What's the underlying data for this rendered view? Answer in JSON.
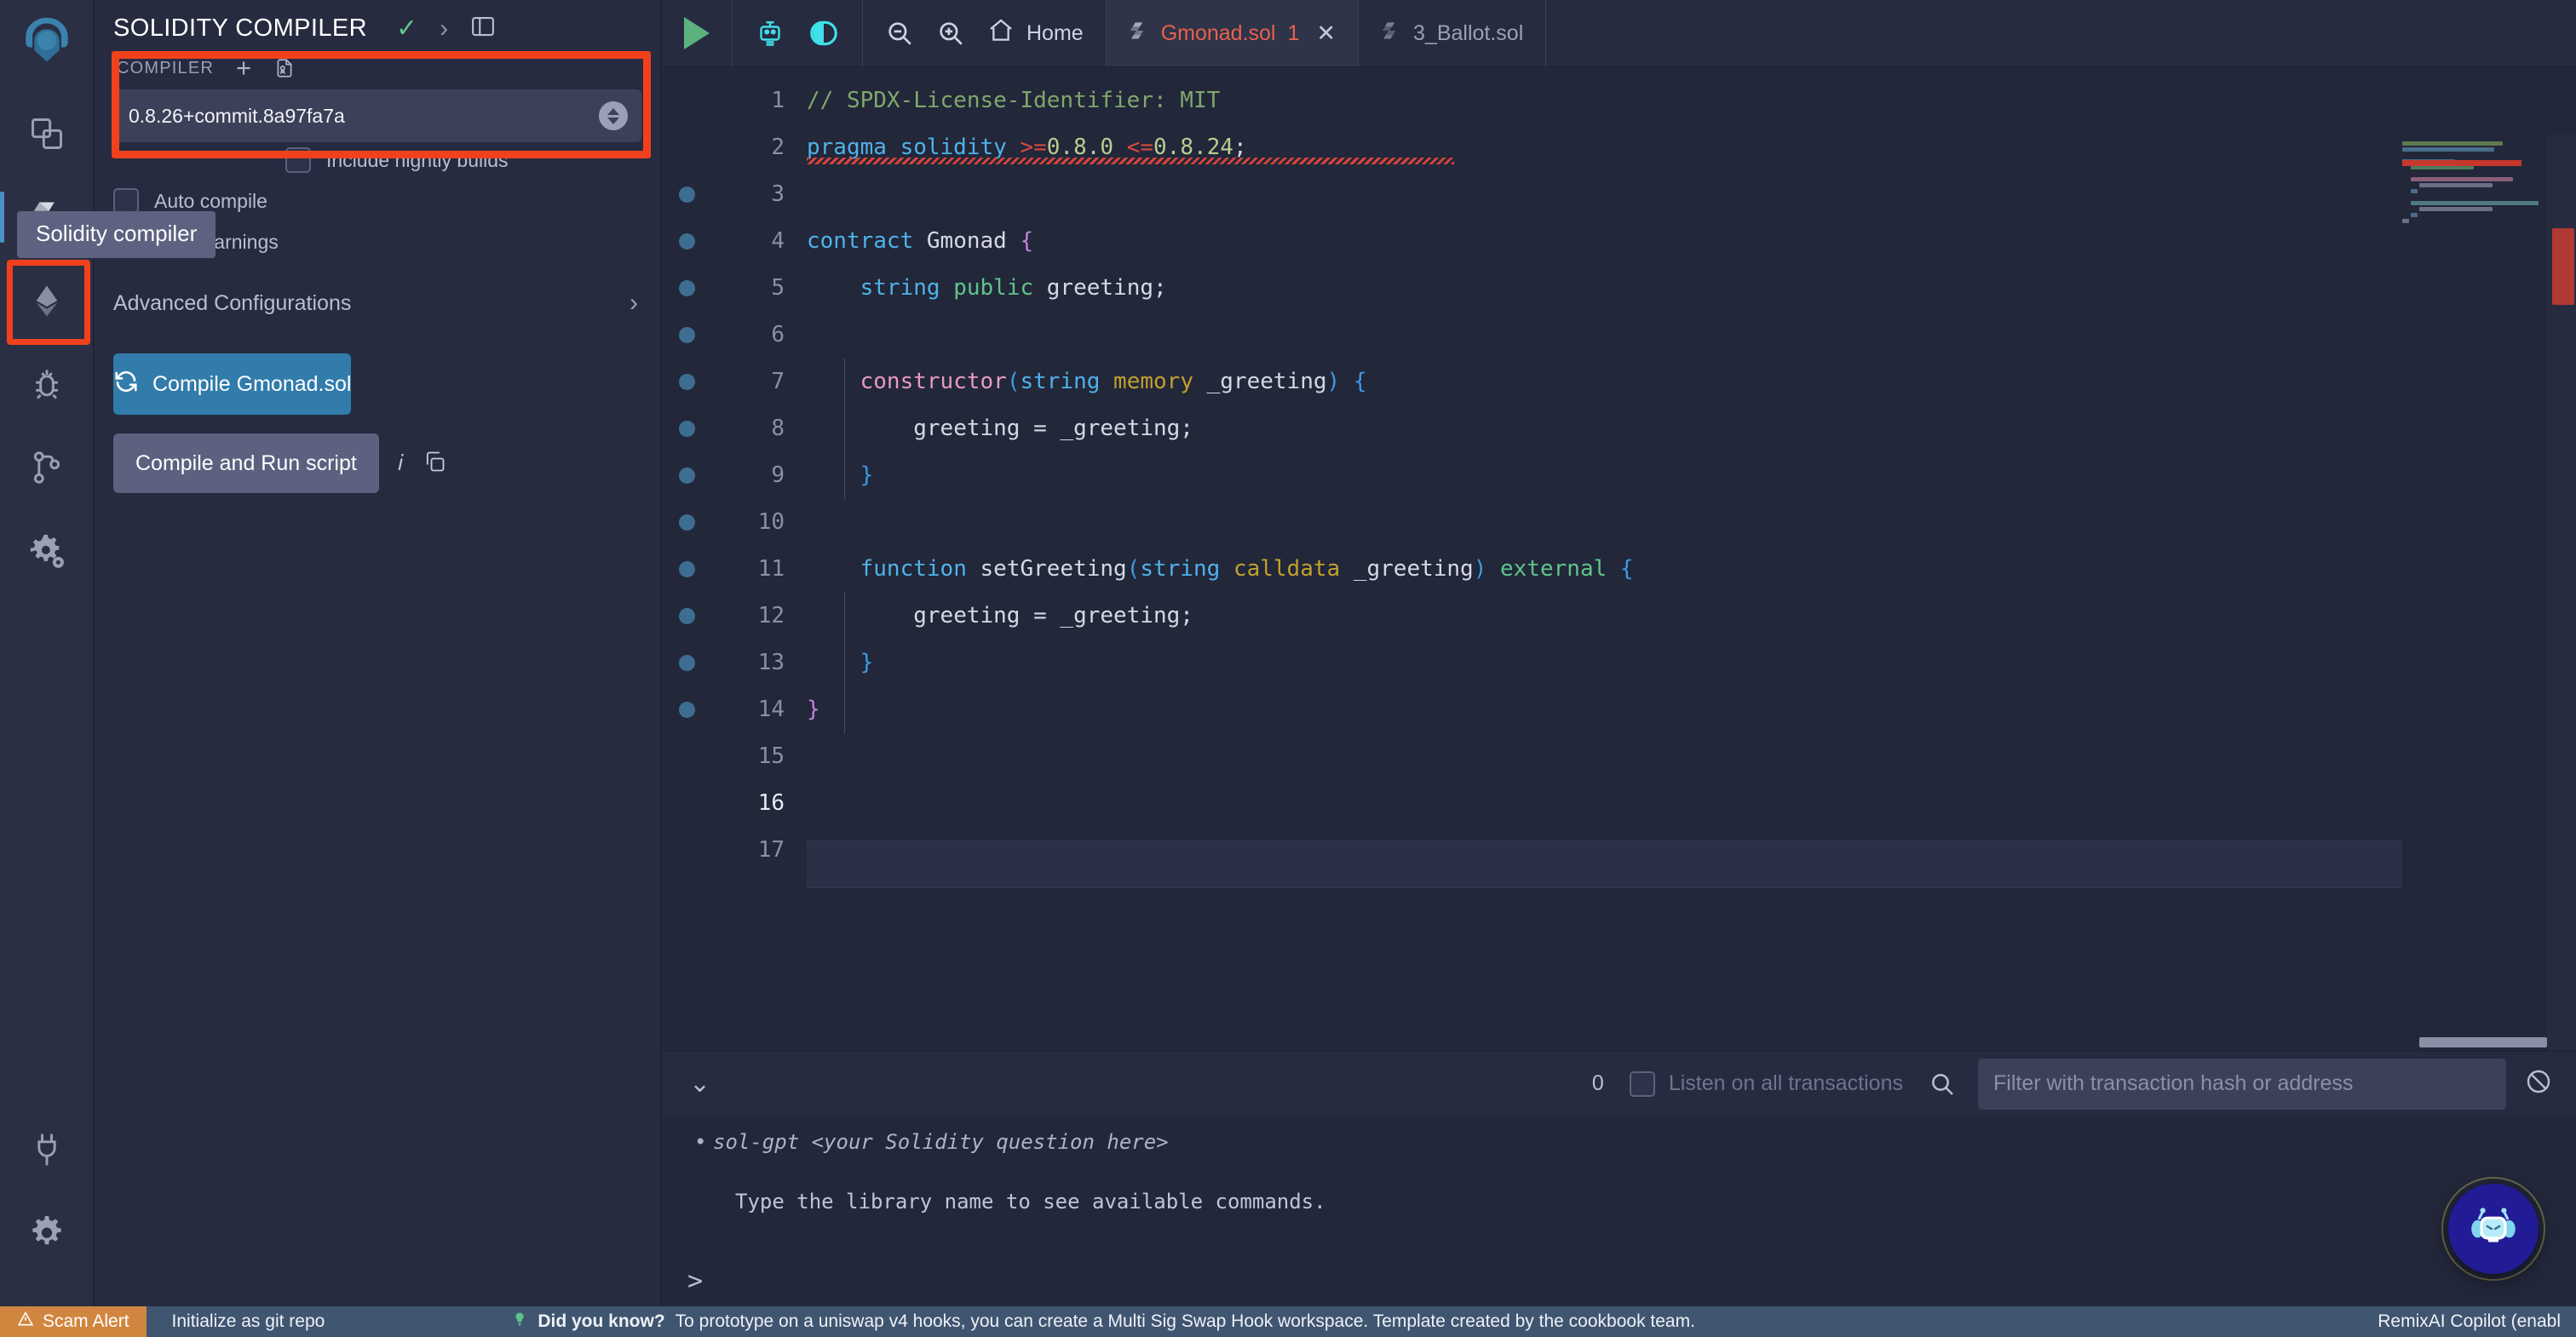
{
  "iconbar": {
    "items": [
      {
        "name": "remix-logo",
        "label": "Remix"
      },
      {
        "name": "file-explorer",
        "label": "File explorer"
      },
      {
        "name": "solidity-compiler",
        "label": "Solidity compiler"
      },
      {
        "name": "deploy-run",
        "label": "Deploy & run transactions"
      },
      {
        "name": "debugger",
        "label": "Debugger"
      },
      {
        "name": "git",
        "label": "Git"
      },
      {
        "name": "plugin-manager-settings",
        "label": "Settings"
      },
      {
        "name": "plugin-manager",
        "label": "Plugin manager"
      },
      {
        "name": "settings",
        "label": "Settings"
      }
    ]
  },
  "tooltip": {
    "text": "Solidity compiler"
  },
  "panel": {
    "title": "SOLIDITY COMPILER",
    "header_icons": [
      "check-icon",
      "chevron-right-icon",
      "panel-layout-icon"
    ],
    "compiler_label": "COMPILER",
    "compiler_version": "0.8.26+commit.8a97fa7a",
    "nightly_label": "Include nightly builds",
    "auto_compile_label": "Auto compile",
    "hide_warnings_label": "Hide warnings",
    "advanced_label": "Advanced Configurations",
    "compile_button": "Compile Gmonad.sol",
    "run_script_button": "Compile and Run script"
  },
  "toolbar": {
    "run_label": "run",
    "home_label": "Home",
    "zoom_out": "zoom-out",
    "zoom_in": "zoom-in"
  },
  "tabs": [
    {
      "label": "Gmonad.sol",
      "count": "1",
      "active": true,
      "closable": true
    },
    {
      "label": "3_Ballot.sol",
      "count": "",
      "active": false,
      "closable": false
    }
  ],
  "editor": {
    "current_line": "16",
    "gutter": [
      "1",
      "2",
      "3",
      "4",
      "5",
      "6",
      "7",
      "8",
      "9",
      "10",
      "11",
      "12",
      "13",
      "14",
      "15",
      "16",
      "17"
    ],
    "lines": [
      "// SPDX-License-Identifier: MIT",
      "pragma solidity >=0.8.0 <=0.8.24;",
      "",
      "contract Gmonad {",
      "    string public greeting;",
      "",
      "    constructor(string memory _greeting) {",
      "        greeting = _greeting;",
      "    }",
      "",
      "    function setGreeting(string calldata _greeting) external {",
      "        greeting = _greeting;",
      "    }",
      "}",
      "",
      "",
      ""
    ]
  },
  "terminal": {
    "count": "0",
    "listen_label": "Listen on all transactions",
    "filter_placeholder": "Filter with transaction hash or address",
    "lines": [
      "sol-gpt <your Solidity question here>",
      "Type the library name to see available commands."
    ],
    "prompt": ">"
  },
  "statusbar": {
    "scam_alert": "Scam Alert",
    "git_label": "Initialize as git repo",
    "tip_title": "Did you know?",
    "tip_text": "To prototype on a uniswap v4 hooks, you can create a Multi Sig Swap Hook workspace. Template created by the cookbook team.",
    "copilot": "RemixAI Copilot (enabl"
  },
  "colors": {
    "accent_red": "#f1411c",
    "compile_blue": "#327cab",
    "bg": "#22273a",
    "panel": "#262b40",
    "status": "#3f5570",
    "scam": "#d1863f"
  }
}
